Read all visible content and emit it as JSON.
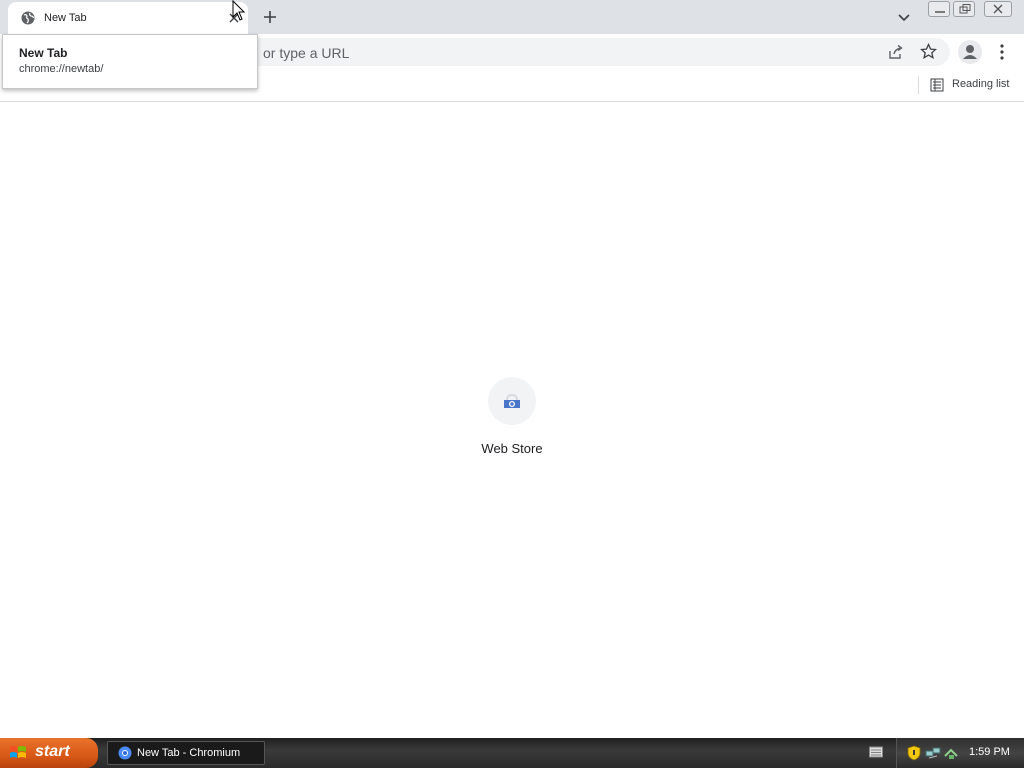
{
  "browser": {
    "tab": {
      "title": "New Tab",
      "favicon": "globe-icon"
    },
    "hovercard": {
      "title": "New Tab",
      "url": "chrome://newtab/"
    },
    "omnibox": {
      "placeholder": "or type a URL"
    },
    "bookmarks_bar": {
      "reading_list_label": "Reading list"
    }
  },
  "page": {
    "shortcuts": [
      {
        "label": "Web Store",
        "icon": "web-store-icon"
      }
    ]
  },
  "taskbar": {
    "start_label": "start",
    "task_items": [
      {
        "label": "New Tab - Chromium",
        "icon": "chromium-icon"
      }
    ],
    "clock": "1:59 PM"
  },
  "colors": {
    "tabstrip": "#dee1e6",
    "omnibox": "#f1f3f4",
    "start_button": "#d85816"
  }
}
